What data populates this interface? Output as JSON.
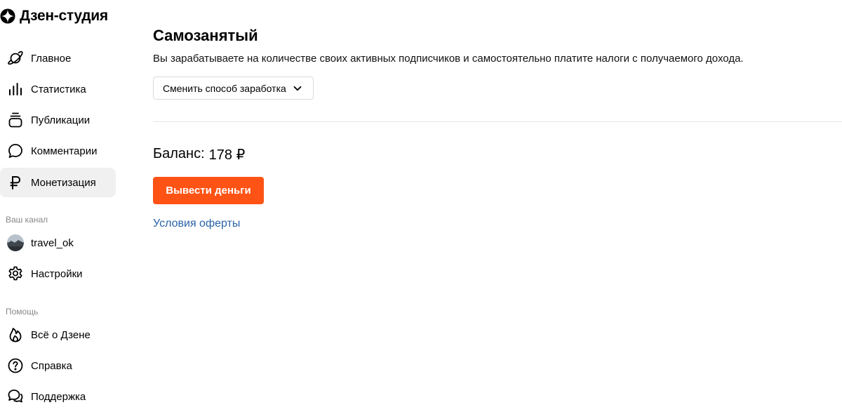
{
  "app": {
    "logo_text": "Дзен-студия"
  },
  "sidebar": {
    "items": [
      {
        "label": "Главное",
        "icon": "planet-icon"
      },
      {
        "label": "Статистика",
        "icon": "bar-chart-icon"
      },
      {
        "label": "Публикации",
        "icon": "stack-icon"
      },
      {
        "label": "Комментарии",
        "icon": "comment-icon"
      },
      {
        "label": "Монетизация",
        "icon": "ruble-icon",
        "active": true
      }
    ],
    "channel_section_label": "Ваш канал",
    "channel": {
      "name": "travel_ok",
      "icon": "avatar"
    },
    "settings_label": "Настройки",
    "help_section_label": "Помощь",
    "help_items": [
      {
        "label": "Всё о Дзене",
        "icon": "flame-icon"
      },
      {
        "label": "Справка",
        "icon": "question-icon"
      },
      {
        "label": "Поддержка",
        "icon": "chat-bubbles-icon"
      }
    ]
  },
  "main": {
    "title": "Самозанятый",
    "description": "Вы зарабатываете на количестве своих активных подписчиков и самостоятельно платите налоги с получаемого дохода.",
    "change_method_label": "Сменить способ заработка",
    "balance_label": "Баланс:",
    "balance_value": "178 ₽",
    "withdraw_label": "Вывести деньги",
    "offer_link": "Условия оферты"
  },
  "colors": {
    "accent": "#ff5315",
    "link": "#2b63a8",
    "active_bg": "#f0f0f1"
  }
}
